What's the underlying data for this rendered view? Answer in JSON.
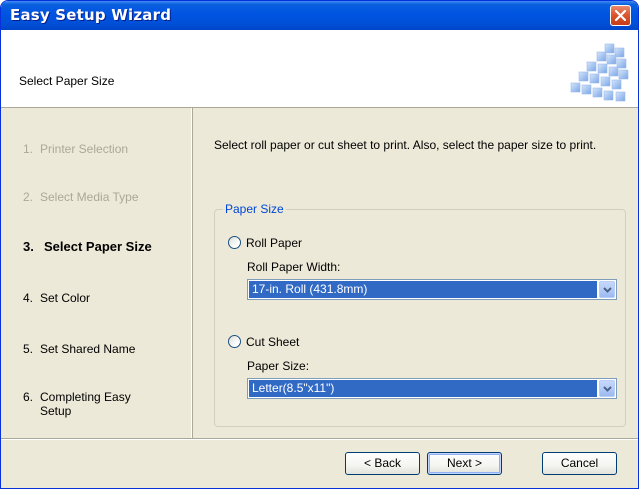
{
  "window": {
    "title": "Easy Setup Wizard"
  },
  "header": {
    "title": "Select Paper Size"
  },
  "steps": [
    {
      "num": "1.",
      "label": "Printer Selection",
      "state": "done"
    },
    {
      "num": "2.",
      "label": "Select Media Type",
      "state": "done"
    },
    {
      "num": "3.",
      "label": "Select Paper Size",
      "state": "current"
    },
    {
      "num": "4.",
      "label": "Set Color",
      "state": "upcoming"
    },
    {
      "num": "5.",
      "label": "Set Shared Name",
      "state": "upcoming"
    },
    {
      "num": "6.",
      "label": "Completing Easy Setup",
      "state": "upcoming"
    }
  ],
  "content": {
    "instruction": "Select roll paper or cut sheet to print. Also, select the paper size to print.",
    "group_label": "Paper Size",
    "roll_paper": {
      "label": "Roll Paper",
      "selected": false,
      "width_label": "Roll Paper Width:",
      "width_value": "17-in. Roll (431.8mm)"
    },
    "cut_sheet": {
      "label": "Cut Sheet",
      "selected": false,
      "size_label": "Paper Size:",
      "size_value": "Letter(8.5\"x11\")"
    }
  },
  "buttons": {
    "back": "< Back",
    "next": "Next >",
    "cancel": "Cancel"
  },
  "colors": {
    "title_bar": "#0054e3",
    "dialog_bg": "#ece9d8",
    "group_label": "#0046d5",
    "selection": "#316ac5",
    "disabled_text": "#aca899"
  }
}
